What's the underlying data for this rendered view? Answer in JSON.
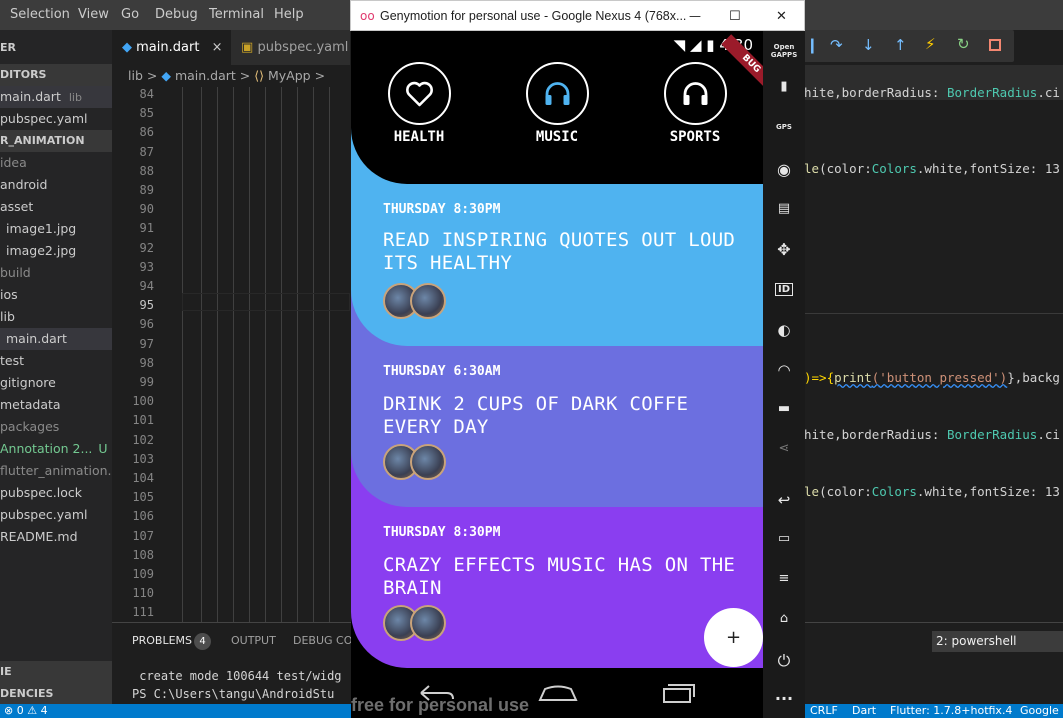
{
  "vscode": {
    "menu": [
      "Selection",
      "View",
      "Go",
      "Debug",
      "Terminal",
      "Help"
    ],
    "sidebar": {
      "open_editors_header": "DITORS",
      "open_editors": [
        {
          "label": "main.dart",
          "suffix": "lib"
        },
        {
          "label": "pubspec.yaml",
          "suffix": ""
        }
      ],
      "project_header": "R_ANIMATION",
      "items": [
        {
          "label": "idea",
          "style": "dim"
        },
        {
          "label": "android",
          "style": "normal"
        },
        {
          "label": "asset",
          "style": "normal"
        },
        {
          "label": "image1.jpg",
          "style": "normal"
        },
        {
          "label": "image2.jpg",
          "style": "normal"
        },
        {
          "label": "build",
          "style": "dim"
        },
        {
          "label": "ios",
          "style": "normal"
        },
        {
          "label": "lib",
          "style": "normal"
        },
        {
          "label": "main.dart",
          "style": "selected"
        },
        {
          "label": "test",
          "style": "normal"
        },
        {
          "label": "gitignore",
          "style": "normal"
        },
        {
          "label": "metadata",
          "style": "normal"
        },
        {
          "label": "packages",
          "style": "dim"
        },
        {
          "label": "Annotation 2...",
          "style": "git",
          "badge": "U"
        },
        {
          "label": "flutter_animation.i...",
          "style": "dim"
        },
        {
          "label": "pubspec.lock",
          "style": "normal"
        },
        {
          "label": "pubspec.yaml",
          "style": "normal"
        },
        {
          "label": "README.md",
          "style": "normal"
        }
      ],
      "bottom1": "IE",
      "bottom2": "DENCIES"
    },
    "tabs": [
      {
        "label": "main.dart",
        "close": "×"
      },
      {
        "label": "pubspec.yaml"
      }
    ],
    "breadcrumb": {
      "p1": "lib",
      "sep": ">",
      "p2": "main.dart",
      "p3": "MyApp"
    },
    "line_numbers": [
      84,
      85,
      86,
      87,
      88,
      89,
      90,
      91,
      92,
      93,
      94,
      95,
      96,
      97,
      98,
      99,
      100,
      101,
      102,
      103,
      104,
      105,
      106,
      107,
      108,
      109,
      110,
      111
    ],
    "current_line": 95,
    "right_code": {
      "l1a": "hite,borderRadius: ",
      "l1b": "BorderRadius",
      "l1c": ".ci",
      "l2a": "le",
      "l2b": "(color:",
      "l2c": "Colors",
      ".": "",
      "l2d": ".white,fontSize: 13",
      "l3a": ")=>{",
      "l3b": "print",
      "l3c": "('button pressed')",
      "l3d": "},backg",
      "l4a": "hite,borderRadius: ",
      "l4b": "BorderRadius",
      "l4c": ".ci",
      "l5a": "le",
      "l5b": "(color:",
      "l5c": "Colors",
      "l5d": ".white,fontSize: 13"
    },
    "panel": {
      "tabs": [
        "PROBLEMS",
        "OUTPUT",
        "DEBUG CON"
      ],
      "problems_count": "4",
      "terminal_select": "2: powershell",
      "line1": " create mode 100644 test/widg",
      "line2": "PS C:\\Users\\tangu\\AndroidStu"
    },
    "status": {
      "left": "⊗ 0 ⚠ 4",
      "crlf": "CRLF",
      "lang": "Dart",
      "flutter": "Flutter: 1.7.8+hotfix.4",
      "extra": "Google"
    }
  },
  "genymotion": {
    "title": "Genymotion for personal use - Google Nexus 4 (768x...",
    "window_buttons": {
      "min": "—",
      "max": "☐",
      "close": "✕"
    },
    "status_time": "4:30",
    "debug_banner": "BUG",
    "categories": [
      {
        "label": "HEALTH",
        "icon": "heart-icon",
        "color": "#ffffff"
      },
      {
        "label": "MUSIC",
        "icon": "headphones-icon",
        "color": "#4fb3f0"
      },
      {
        "label": "SPORTS",
        "icon": "headphones-icon",
        "color": "#ffffff"
      }
    ],
    "cards": [
      {
        "time": "THURSDAY 8:30PM",
        "title": "READ INSPIRING QUOTES OUT LOUD ITS HEALTHY",
        "color": "#4fb3f0"
      },
      {
        "time": "THURSDAY 6:30AM",
        "title": "DRINK 2 CUPS OF DARK COFFE EVERY DAY",
        "color": "#6c6fe0"
      },
      {
        "time": "THURSDAY 8:30PM",
        "title": "CRAZY EFFECTS MUSIC HAS ON THE BRAIN",
        "color": "#8a3ef0"
      }
    ],
    "fab_label": "+",
    "watermark": "free for personal use",
    "side_icons": [
      "open-gapps-icon",
      "battery-icon",
      "gps-icon",
      "camera-icon",
      "clapper-icon",
      "move-icon",
      "id-icon",
      "disc-icon",
      "rss-icon",
      "chat-icon",
      "share-icon",
      "back-icon",
      "recents-icon",
      "menu-icon",
      "home-icon",
      "power-icon",
      "more-icon"
    ],
    "side_open_gapps": "Open GAPPS",
    "side_gps": "GPS",
    "side_id": "ID"
  }
}
